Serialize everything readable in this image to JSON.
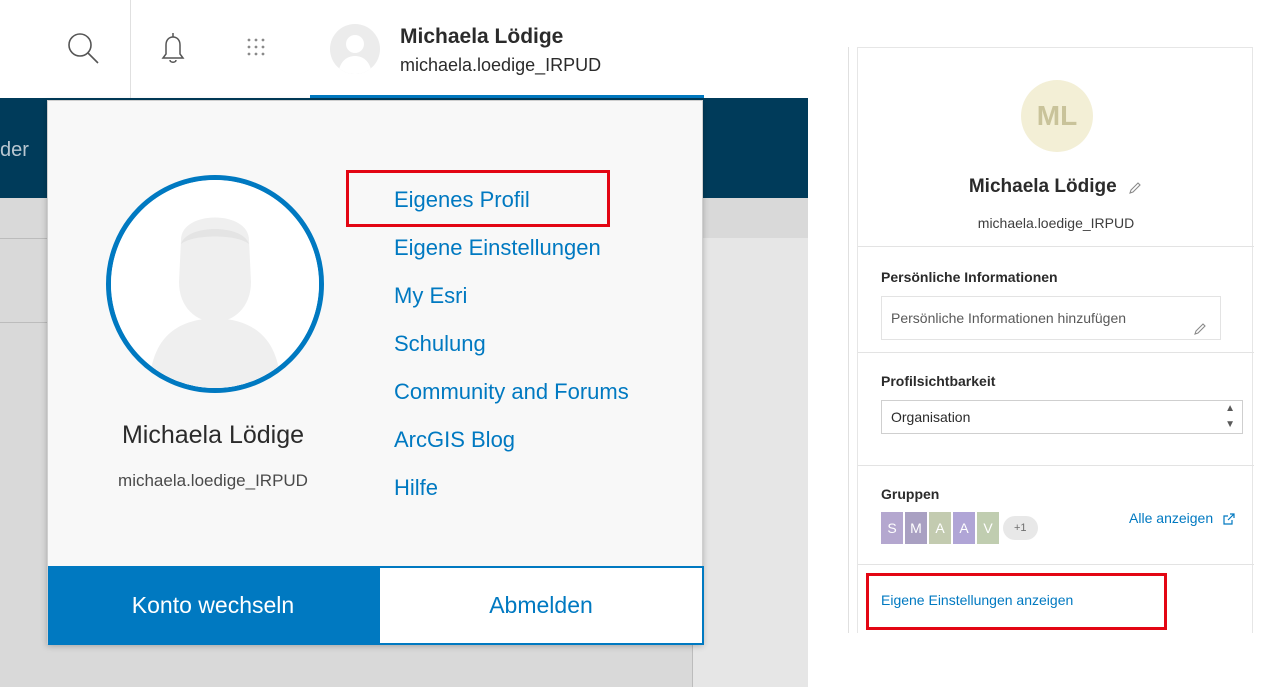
{
  "header": {
    "user_name": "Michaela Lödige",
    "username": "michaela.loedige_IRPUD",
    "icons": [
      "search-icon",
      "bell-icon",
      "apps-grid-icon",
      "avatar"
    ]
  },
  "navbar": {
    "partial_text": "der"
  },
  "dropdown": {
    "user_name": "Michaela Lödige",
    "username": "michaela.loedige_IRPUD",
    "links": [
      "Eigenes Profil",
      "Eigene Einstellungen",
      "My Esri",
      "Schulung",
      "Community and Forums",
      "ArcGIS Blog",
      "Hilfe"
    ],
    "switch_account_label": "Konto wechseln",
    "sign_out_label": "Abmelden"
  },
  "profile_card": {
    "initials": "ML",
    "user_name": "Michaela Lödige",
    "username": "michaela.loedige_IRPUD",
    "personal_info_label": "Persönliche Informationen",
    "personal_info_placeholder": "Persönliche Informationen hinzufügen",
    "visibility_label": "Profilsichtbarkeit",
    "visibility_value": "Organisation",
    "groups_label": "Gruppen",
    "groups": [
      {
        "letter": "S",
        "color": "#b4a7cf"
      },
      {
        "letter": "M",
        "color": "#a9a0c2"
      },
      {
        "letter": "A",
        "color": "#c3cbb0"
      },
      {
        "letter": "A",
        "color": "#b0a5d6"
      },
      {
        "letter": "V",
        "color": "#c0cdb0"
      }
    ],
    "groups_more": "+1",
    "show_all_label": "Alle anzeigen",
    "settings_link": "Eigene Einstellungen anzeigen"
  },
  "colors": {
    "accent": "#0079c1",
    "navbar": "#003b5a",
    "highlight": "#e30613"
  }
}
